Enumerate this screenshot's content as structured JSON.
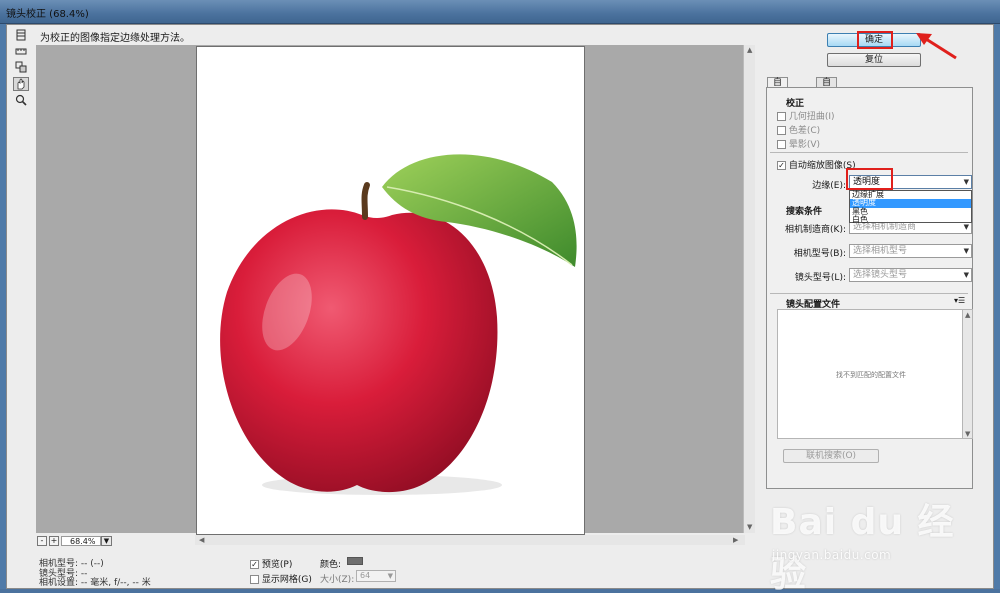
{
  "window": {
    "title": "镜头校正 (68.4%)"
  },
  "hint": "为校正的图像指定边缘处理方法。",
  "tools": [
    {
      "icon": "remove-distortion-icon"
    },
    {
      "icon": "straighten-icon"
    },
    {
      "icon": "move-grid-icon"
    },
    {
      "icon": "hand-icon"
    },
    {
      "icon": "zoom-icon"
    }
  ],
  "buttons": {
    "ok": "确定",
    "reset": "复位"
  },
  "tabs": [
    {
      "label": "自动校正"
    },
    {
      "label": "自定"
    }
  ],
  "correction": {
    "title": "校正",
    "options": [
      {
        "label": "几何扭曲(I)",
        "checked": false
      },
      {
        "label": "色差(C)",
        "checked": false
      },
      {
        "label": "晕影(V)",
        "checked": false
      }
    ],
    "auto_scale": {
      "label": "自动缩放图像(S)",
      "checked": true
    },
    "edge": {
      "label": "边缘(E):",
      "value": "透明度",
      "options": [
        "边缘扩展",
        "透明度",
        "黑色",
        "白色"
      ],
      "selected_index": 1
    }
  },
  "search": {
    "title": "搜索条件",
    "camera_make": {
      "label": "相机制造商(K):",
      "placeholder": "选择相机制造商"
    },
    "camera_model": {
      "label": "相机型号(B):",
      "placeholder": "选择相机型号"
    },
    "lens_model": {
      "label": "镜头型号(L):",
      "placeholder": "选择镜头型号"
    }
  },
  "profiles": {
    "title": "镜头配置文件",
    "menu_icon": "panel-menu-icon",
    "empty": "找不到匹配的配置文件",
    "online_search": "联机搜索(O)"
  },
  "zoom": {
    "value": "68.4%",
    "minus": "-",
    "plus": "+"
  },
  "info": {
    "camera_model": "相机型号: -- (--)",
    "lens_model": "镜头型号: --",
    "camera_settings": "相机设置: -- 毫米, f/--, -- 米"
  },
  "preview": {
    "label": "预览(P)",
    "checked": true
  },
  "show_grid": {
    "label": "显示网格(G)",
    "checked": false
  },
  "color": {
    "label": "颜色:",
    "value": "#6e6e6e"
  },
  "size": {
    "label": "大小(Z):",
    "value": "64"
  },
  "watermark": {
    "brand": "Bai du 经验",
    "url": "jingyan.baidu.com"
  },
  "colors": {
    "highlight": "#e0201c",
    "selection": "#3399ff",
    "canvas_bg": "#a9a9a9"
  }
}
